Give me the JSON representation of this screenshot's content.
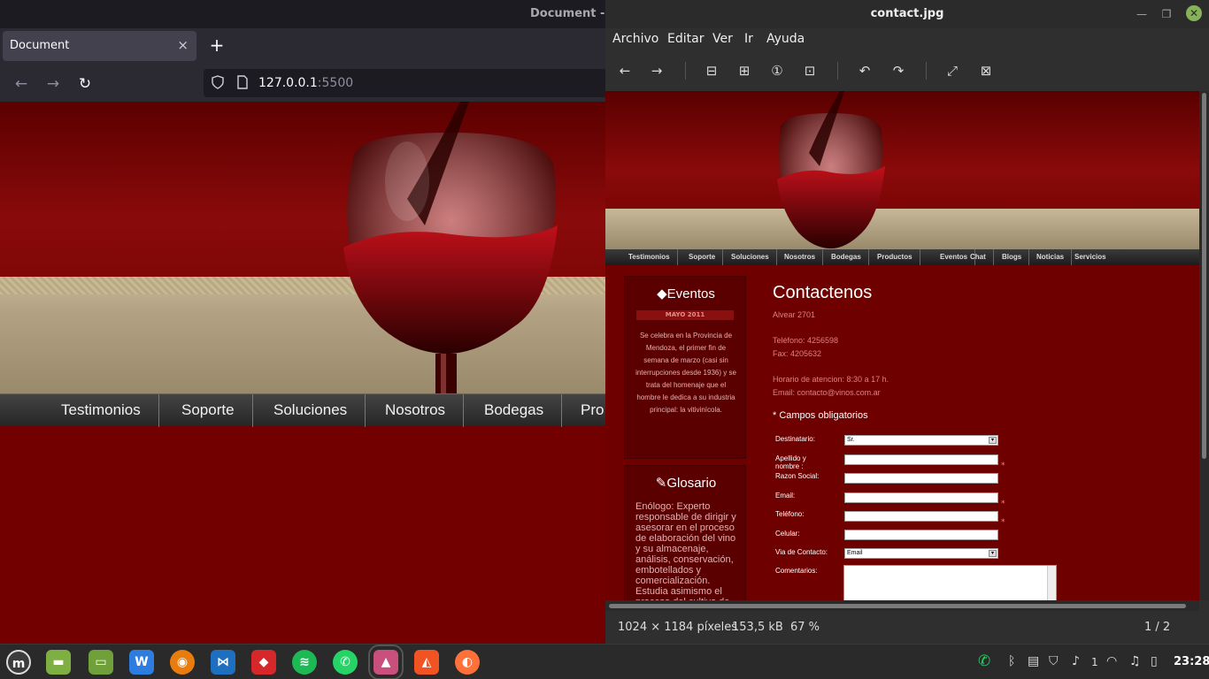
{
  "browser": {
    "window_title": "Document - M",
    "tab_title": "Document",
    "tab_close": "×",
    "new_tab": "+",
    "url_host": "127.0.0.1",
    "url_port": ":5500",
    "back": "←",
    "forward": "→",
    "reload": "↻",
    "menu": [
      "Testimonios",
      "Soporte",
      "Soluciones",
      "Nosotros",
      "Bodegas",
      "Pro"
    ]
  },
  "viewer": {
    "title": "contact.jpg",
    "menu": [
      "Archivo",
      "Editar",
      "Ver",
      "Ir",
      "Ayuda"
    ],
    "toolbar": {
      "prev": "←",
      "next": "→",
      "zoom_out": "⊟",
      "zoom_in": "⊞",
      "zoom_1": "①",
      "zoom_fit": "⊡",
      "rotate_left": "↶",
      "rotate_right": "↷",
      "fullscreen": "⤢",
      "slideshow": "⊠"
    },
    "status": {
      "dimensions": "1024 × 1184 píxeles",
      "size": "153,5 kB",
      "zoom": "67 %",
      "page": "1 / 2"
    },
    "image": {
      "menu": [
        "Testimonios",
        "Soporte",
        "Soluciones",
        "Nosotros",
        "Bodegas",
        "Productos",
        "Eventos",
        "Chat",
        "Blogs",
        "Noticias",
        "Servicios"
      ],
      "eventos": {
        "title": "Eventos",
        "month": "MAYO 2011",
        "text": "Se celebra en la Provincia de Mendoza, el primer fin de semana de marzo (casi sin interrupciones desde 1936) y se trata del homenaje que el hombre le dedica a su industria principal: la vitivinícola."
      },
      "glosario": {
        "title": "Glosario",
        "text": "Enólogo: Experto responsable de dirigir y asesorar en el proceso de elaboración del vino y su almacenaje, análisis, conservación, embotellados y comercialización. Estudia asimismo el proceso del cultivo de la"
      },
      "contact": {
        "title": "Contactenos",
        "address": "Alvear 2701",
        "phone": "Teléfono: 4256598",
        "fax": "Fax: 4205632",
        "hours": "Horario de atencion: 8:30 a 17 h.",
        "email": "Email: contacto@vinos.com.ar",
        "required": "* Campos obligatorios"
      },
      "form": {
        "destinatario": "Destinatario:",
        "destinatario_value": "Sr.",
        "apellido": "Apellido y nombre :",
        "razon": "Razon Social:",
        "email": "Email:",
        "telefono": "Teléfono:",
        "celular": "Celular:",
        "via": "Via de Contacto:",
        "via_value": "Email",
        "comentarios": "Comentarios:",
        "star": "*"
      }
    }
  },
  "taskbar": {
    "apps": [
      "mint-menu",
      "files",
      "folder",
      "wps-office",
      "blender",
      "vscode",
      "git",
      "spotify",
      "whatsapp",
      "image-viewer",
      "brave",
      "firefox"
    ],
    "tray_notifications": "1",
    "clock": "23:28"
  }
}
